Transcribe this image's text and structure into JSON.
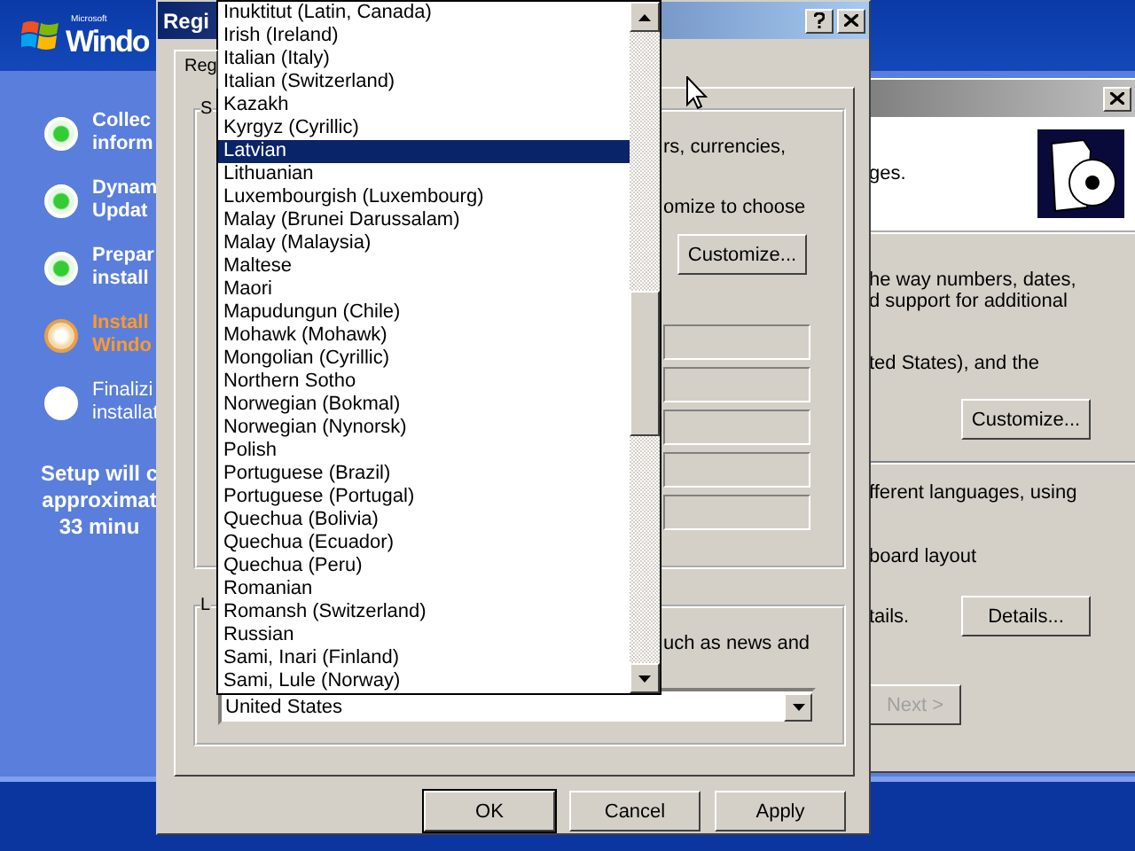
{
  "setup": {
    "logo_small": "Microsoft",
    "logo_text": "Windo",
    "steps": [
      {
        "lines": [
          "Collec",
          "inform"
        ],
        "kind": "done"
      },
      {
        "lines": [
          "Dynam",
          "Updat"
        ],
        "kind": "done"
      },
      {
        "lines": [
          "Prepar",
          "install"
        ],
        "kind": "done"
      },
      {
        "lines": [
          "Install",
          "Windo"
        ],
        "kind": "current"
      },
      {
        "lines": [
          "Finalizi",
          "installat"
        ],
        "kind": "pending"
      }
    ],
    "estimate": [
      "Setup will c",
      "approximat",
      "33 minu"
    ]
  },
  "back_window": {
    "header_text": "ges.",
    "section_1": [
      "he way numbers, dates,",
      "d support for additional"
    ],
    "section_2": "ted States), and the",
    "customize_button": "Customize...",
    "section_3": "fferent languages, using",
    "section_4": "board layout",
    "section_5": "tails.",
    "details_button": "Details...",
    "next_button": {
      "label": "Next >",
      "disabled": true
    }
  },
  "dialog": {
    "title": "Regi",
    "tabs": [
      {
        "label": "Reg",
        "selected": true
      }
    ],
    "group_1": {
      "label": "S",
      "lines": [
        "rs, currencies,",
        "omize to choose"
      ],
      "button": "Customize..."
    },
    "group_2": {
      "label": "L",
      "text": "uch as news and",
      "location": "United States"
    },
    "buttons": [
      {
        "label": "OK",
        "default": true
      },
      {
        "label": "Cancel",
        "default": false
      },
      {
        "label": "Apply",
        "default": false
      }
    ]
  },
  "dropdown": {
    "items": [
      {
        "label": "Inuktitut (Latin, Canada)",
        "selected": false
      },
      {
        "label": "Irish (Ireland)",
        "selected": false
      },
      {
        "label": "Italian (Italy)",
        "selected": false
      },
      {
        "label": "Italian (Switzerland)",
        "selected": false
      },
      {
        "label": "Kazakh",
        "selected": false
      },
      {
        "label": "Kyrgyz (Cyrillic)",
        "selected": false
      },
      {
        "label": "Latvian",
        "selected": true
      },
      {
        "label": "Lithuanian",
        "selected": false
      },
      {
        "label": "Luxembourgish (Luxembourg)",
        "selected": false
      },
      {
        "label": "Malay (Brunei Darussalam)",
        "selected": false
      },
      {
        "label": "Malay (Malaysia)",
        "selected": false
      },
      {
        "label": "Maltese",
        "selected": false
      },
      {
        "label": "Maori",
        "selected": false
      },
      {
        "label": "Mapudungun (Chile)",
        "selected": false
      },
      {
        "label": "Mohawk (Mohawk)",
        "selected": false
      },
      {
        "label": "Mongolian (Cyrillic)",
        "selected": false
      },
      {
        "label": "Northern Sotho",
        "selected": false
      },
      {
        "label": "Norwegian (Bokmal)",
        "selected": false
      },
      {
        "label": "Norwegian (Nynorsk)",
        "selected": false
      },
      {
        "label": "Polish",
        "selected": false
      },
      {
        "label": "Portuguese (Brazil)",
        "selected": false
      },
      {
        "label": "Portuguese (Portugal)",
        "selected": false
      },
      {
        "label": "Quechua (Bolivia)",
        "selected": false
      },
      {
        "label": "Quechua (Ecuador)",
        "selected": false
      },
      {
        "label": "Quechua (Peru)",
        "selected": false
      },
      {
        "label": "Romanian",
        "selected": false
      },
      {
        "label": "Romansh (Switzerland)",
        "selected": false
      },
      {
        "label": "Russian",
        "selected": false
      },
      {
        "label": "Sami, Inari (Finland)",
        "selected": false
      },
      {
        "label": "Sami, Lule (Norway)",
        "selected": false
      }
    ]
  }
}
